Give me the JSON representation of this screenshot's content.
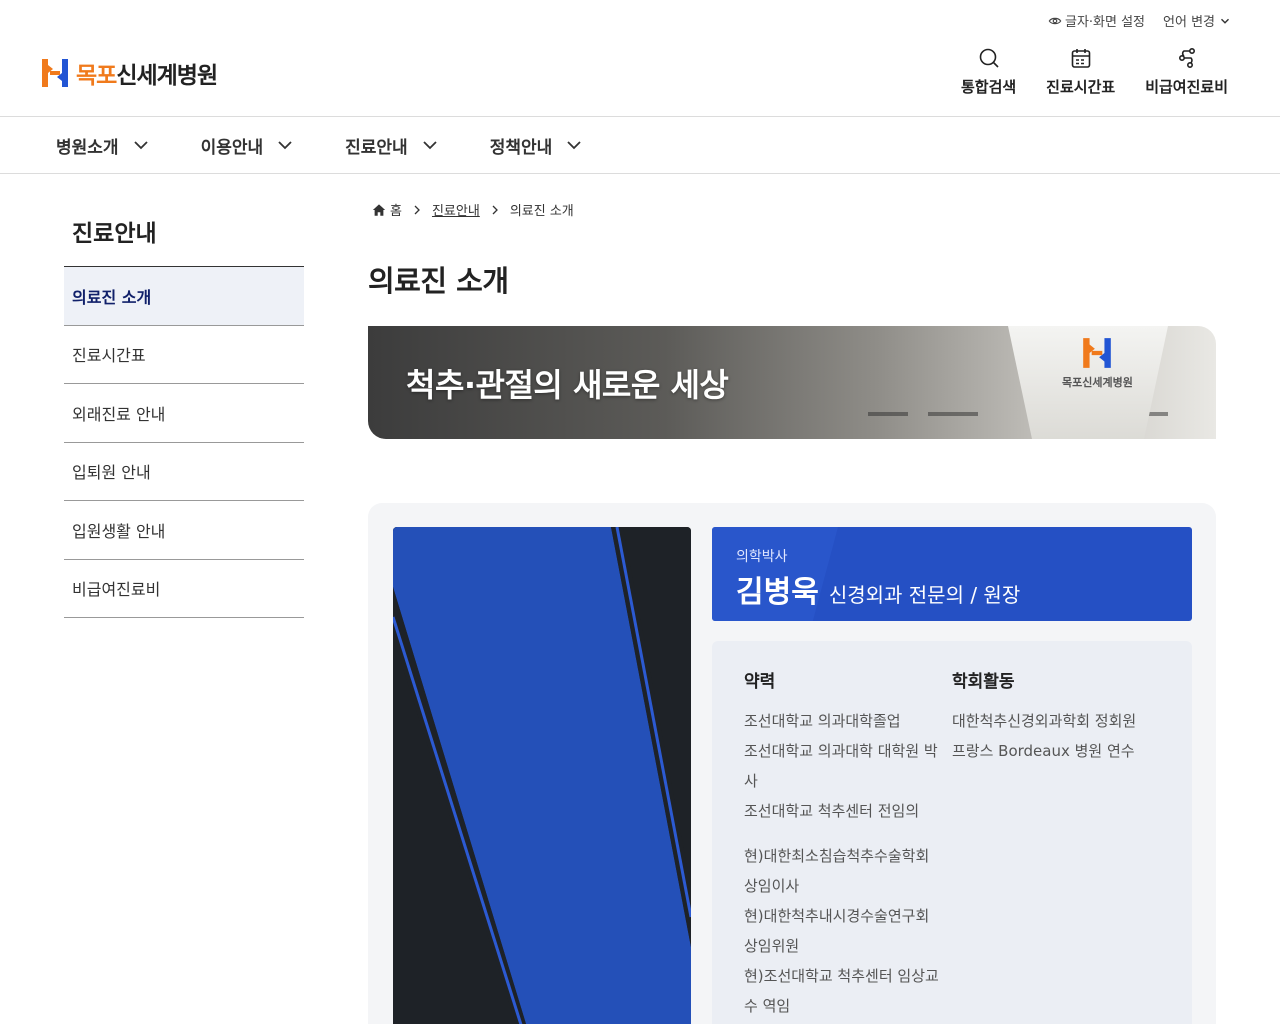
{
  "utility": {
    "font_setting": "글자·화면 설정",
    "language": "언어 변경"
  },
  "logo": {
    "orange": "목포",
    "black": "신세계병원"
  },
  "quick_links": [
    {
      "label": "통합검색",
      "icon": "search-icon"
    },
    {
      "label": "진료시간표",
      "icon": "calendar-icon"
    },
    {
      "label": "비급여진료비",
      "icon": "route-icon"
    }
  ],
  "gnb": [
    {
      "label": "병원소개"
    },
    {
      "label": "이용안내"
    },
    {
      "label": "진료안내"
    },
    {
      "label": "정책안내"
    }
  ],
  "side": {
    "title": "진료안내",
    "items": [
      {
        "label": "의료진 소개",
        "active": true
      },
      {
        "label": "진료시간표"
      },
      {
        "label": "외래진료 안내"
      },
      {
        "label": "입퇴원 안내"
      },
      {
        "label": "입원생활 안내"
      },
      {
        "label": "비급여진료비"
      }
    ]
  },
  "breadcrumb": {
    "home": "홈",
    "level1": "진료안내",
    "level2": "의료진 소개"
  },
  "page_title": "의료진 소개",
  "banner": {
    "text": "척추·관절의 새로운 세상",
    "logo_text": "목포신세계병원"
  },
  "doctor": {
    "degree": "의학박사",
    "name": "김병욱",
    "department": "신경외과 전문의 / 원장",
    "career_title": "약력",
    "career_1": [
      "조선대학교 의과대학졸업",
      "조선대학교 의과대학 대학원 박사",
      "조선대학교 척추센터 전임의"
    ],
    "career_2": [
      "현)대한최소침습척추수술학회 상임이사",
      "현)대한척추내시경수술연구회 상임위원",
      "현)조선대학교 척추센터 임상교수 역임"
    ],
    "society_title": "학회활동",
    "society": [
      "대한척추신경외과학회 정회원",
      "프랑스 Bordeaux 병원 연수"
    ]
  },
  "colors": {
    "brand_orange": "#f07a1c",
    "brand_blue": "#2550c4",
    "active_nav_bg": "#eef1f7"
  }
}
